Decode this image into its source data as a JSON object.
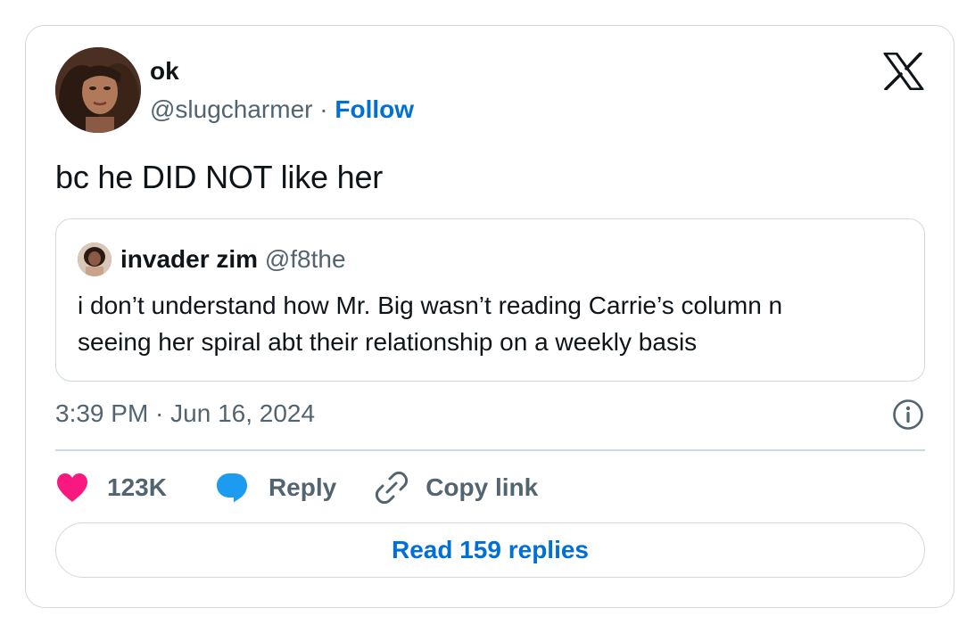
{
  "author": {
    "display_name": "ok",
    "handle": "@slugcharmer",
    "separator": " · ",
    "follow_label": "Follow"
  },
  "tweet": {
    "text": "bc he DID NOT like her",
    "timestamp": "3:39 PM · Jun 16, 2024"
  },
  "quoted_tweet": {
    "display_name": "invader zim",
    "handle": "@f8the",
    "text_line1": "i don’t understand how Mr. Big wasn’t  reading Carrie’s column n",
    "text_line2": "seeing her spiral abt their relationship on a weekly basis"
  },
  "actions": {
    "like_count": "123K",
    "reply_label": "Reply",
    "copy_link_label": "Copy link"
  },
  "read_replies_label": "Read 159 replies",
  "colors": {
    "like": "#f91880",
    "reply": "#1d9bf0",
    "link": "#006fd6",
    "secondary_text": "#536471",
    "border": "#cfd9de"
  },
  "icons": [
    "avatar",
    "x-logo-icon",
    "info-icon",
    "heart-icon",
    "speech-bubble-icon",
    "link-icon"
  ]
}
